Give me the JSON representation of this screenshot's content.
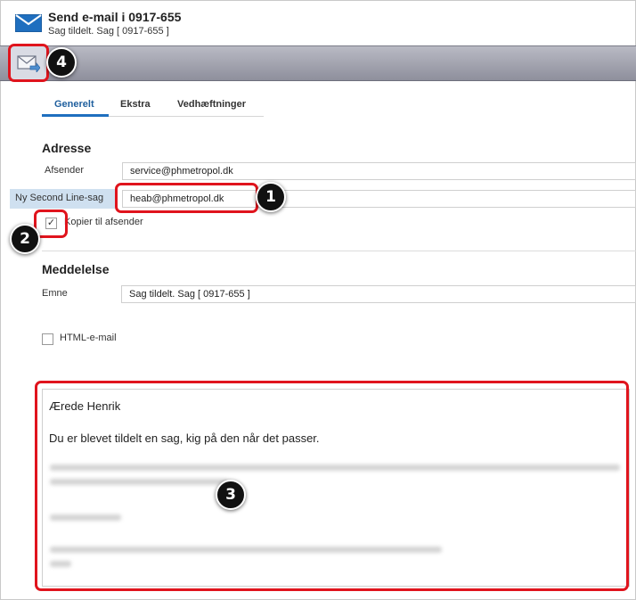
{
  "header": {
    "title": "Send e-mail i 0917-655",
    "subtitle": "Sag tildelt. Sag [ 0917-655 ]",
    "icon": "envelope-icon"
  },
  "toolbar": {
    "send_icon": "send-envelope-icon"
  },
  "badges": {
    "b1": "1",
    "b2": "2",
    "b3": "3",
    "b4": "4"
  },
  "tabs": [
    {
      "label": "Generelt",
      "active": true
    },
    {
      "label": "Ekstra",
      "active": false
    },
    {
      "label": "Vedhæftninger",
      "active": false
    }
  ],
  "address": {
    "section_title": "Adresse",
    "sender_label": "Afsender",
    "sender_value": "service@phmetropol.dk",
    "recipient_label": "Ny Second Line-sag",
    "recipient_value": "heab@phmetropol.dk",
    "copy_label": "Kopier til afsender",
    "copy_checked": "✓"
  },
  "message": {
    "section_title": "Meddelelse",
    "subject_label": "Emne",
    "subject_value": "Sag tildelt. Sag [ 0917-655 ]",
    "html_label": "HTML-e-mail",
    "greeting": "Ærede Henrik",
    "line1": "Du er blevet tildelt en sag, kig på den når det passer."
  },
  "colors": {
    "highlight": "#e0141d",
    "accent": "#1f6fbf",
    "toolbar": "#9d9eab"
  }
}
